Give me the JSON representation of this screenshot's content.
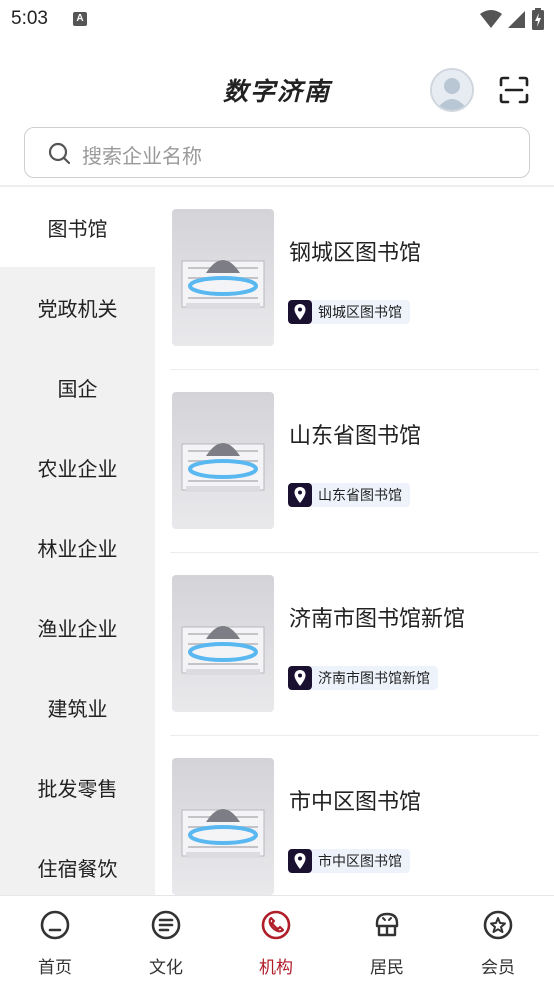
{
  "status_bar": {
    "time": "5:03",
    "notification_letter": "A"
  },
  "header": {
    "title": "数字济南"
  },
  "search": {
    "placeholder": "搜索企业名称"
  },
  "sidebar": {
    "items": [
      {
        "label": "图书馆",
        "active": true
      },
      {
        "label": "党政机关"
      },
      {
        "label": "国企"
      },
      {
        "label": "农业企业"
      },
      {
        "label": "林业企业"
      },
      {
        "label": "渔业企业"
      },
      {
        "label": "建筑业"
      },
      {
        "label": "批发零售"
      },
      {
        "label": "住宿餐饮"
      }
    ]
  },
  "list": {
    "items": [
      {
        "title": "钢城区图书馆",
        "tag": "钢城区图书馆"
      },
      {
        "title": "山东省图书馆",
        "tag": "山东省图书馆"
      },
      {
        "title": "济南市图书馆新馆",
        "tag": "济南市图书馆新馆"
      },
      {
        "title": "市中区图书馆",
        "tag": "市中区图书馆"
      }
    ]
  },
  "bottom_nav": {
    "items": [
      {
        "label": "首页",
        "icon": "home-icon"
      },
      {
        "label": "文化",
        "icon": "culture-icon"
      },
      {
        "label": "机构",
        "icon": "institution-icon",
        "active": true
      },
      {
        "label": "居民",
        "icon": "resident-icon"
      },
      {
        "label": "会员",
        "icon": "member-icon"
      }
    ]
  },
  "colors": {
    "accent": "#b01e2a",
    "tag_bg": "#eef3fb",
    "sidebar_bg": "#f1f1f1"
  }
}
